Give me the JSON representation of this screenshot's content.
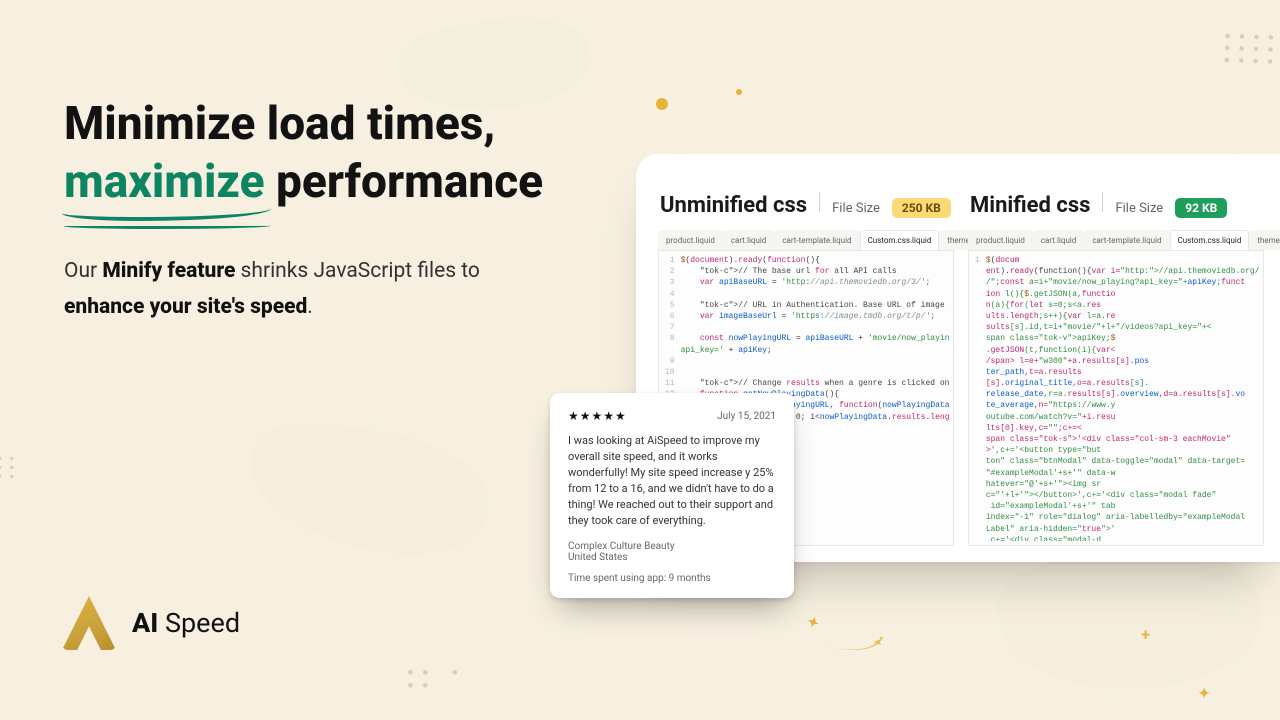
{
  "hero": {
    "line1": "Minimize load times,",
    "highlight": "maximize",
    "rest": "performance"
  },
  "sub": {
    "pre": "Our ",
    "bold1": "Minify feature",
    "mid": " shrinks JavaScript files to ",
    "bold2": "enhance your site's speed",
    "post": "."
  },
  "brand": {
    "prefix": "AI",
    "name": " Speed"
  },
  "compare": {
    "file_size_label": "File Size",
    "tabs": [
      "product.liquid",
      "cart.liquid",
      "cart-template.liquid",
      "Custom.css.liquid",
      "theme.liquid"
    ],
    "active_tab_index": 3,
    "left": {
      "title": "Unminified css",
      "badge": "250 KB",
      "gutter": "1\n2\n3\n4\n5\n6\n7\n8\n\n9\n10\n11\n12\n13",
      "code": "$(document).ready(function(){\n    // The base url for all API calls\n    var apiBaseURL = 'http://api.themoviedb.org/3/';\n\n    // URL in Authentication. Base URL of image\n    var imageBaseUrl = 'https://image.tmdb.org/t/p/';\n\n    const nowPlayingURL = apiBaseURL + 'movie/now_playing?\napi_key=' + apiKey;\n\n\n    // Change results when a genre is clicked on.\n    function getNowPlayingData(){\n        $.getJSON(nowPlayingURL, function(nowPlayingData){\n            for(let i = 0; i<nowPlayingData.results.length"
    },
    "right": {
      "title": "Minified css",
      "badge": "92 KB",
      "gutter": "1",
      "code": "$(document).ready(function(){var i=\"http://api.themoviedb.org/3/\",e=\"https://image.tmdb.org/t/p/\";const a=i+\"movie/now_playing?api_key=\"+apiKey;function l(){$.getJSON(a,function(a){for(let s=0;s<a.results.length;s++){var l=a.results[s].id,t=i+\"movie/\"+l+\"/videos?api_key=\"+apiKey;$.getJSON(t,function(i){var l=e+\"w300\"+a.results[s].poster_path,t=a.results[s].original_title,o=a.results[s].release_date,r=a.results[s].overview,d=a.results[s].vote_average,n=\"https://www.youtube.com/watch?v=\"+i.results[0].key,c=\"\";c+='<div class=\"col-sm-3 eachMovie\">',c+='<button type=\"button\" class=\"btnModal\" data-toggle=\"modal\" data-target=\"#exampleModal'+s+'\" data-whatever=\"@'+s+'\"><img src=\"'+l+'\"></button>',c+='<div class=\"modal fade\" id=\"exampleModal'+s+'\" tabindex=\"-1\" role=\"dialog\" aria-labelledby=\"exampleModalLabel\" aria-hidden=\"true\">',c+='<div class=\"modal-dialog\""
    }
  },
  "review": {
    "stars": "★★★★★",
    "date": "July 15, 2021",
    "text": "I was looking at AiSpeed to improve my overall site speed, and it works wonderfully! My site speed increase y 25% from 12 to a 16, and we didn't have to do a thing! We reached out to their support and they took care of everything.",
    "author": "Complex Culture Beauty",
    "country": "United States",
    "time_spent": "Time spent using app: 9 months"
  }
}
